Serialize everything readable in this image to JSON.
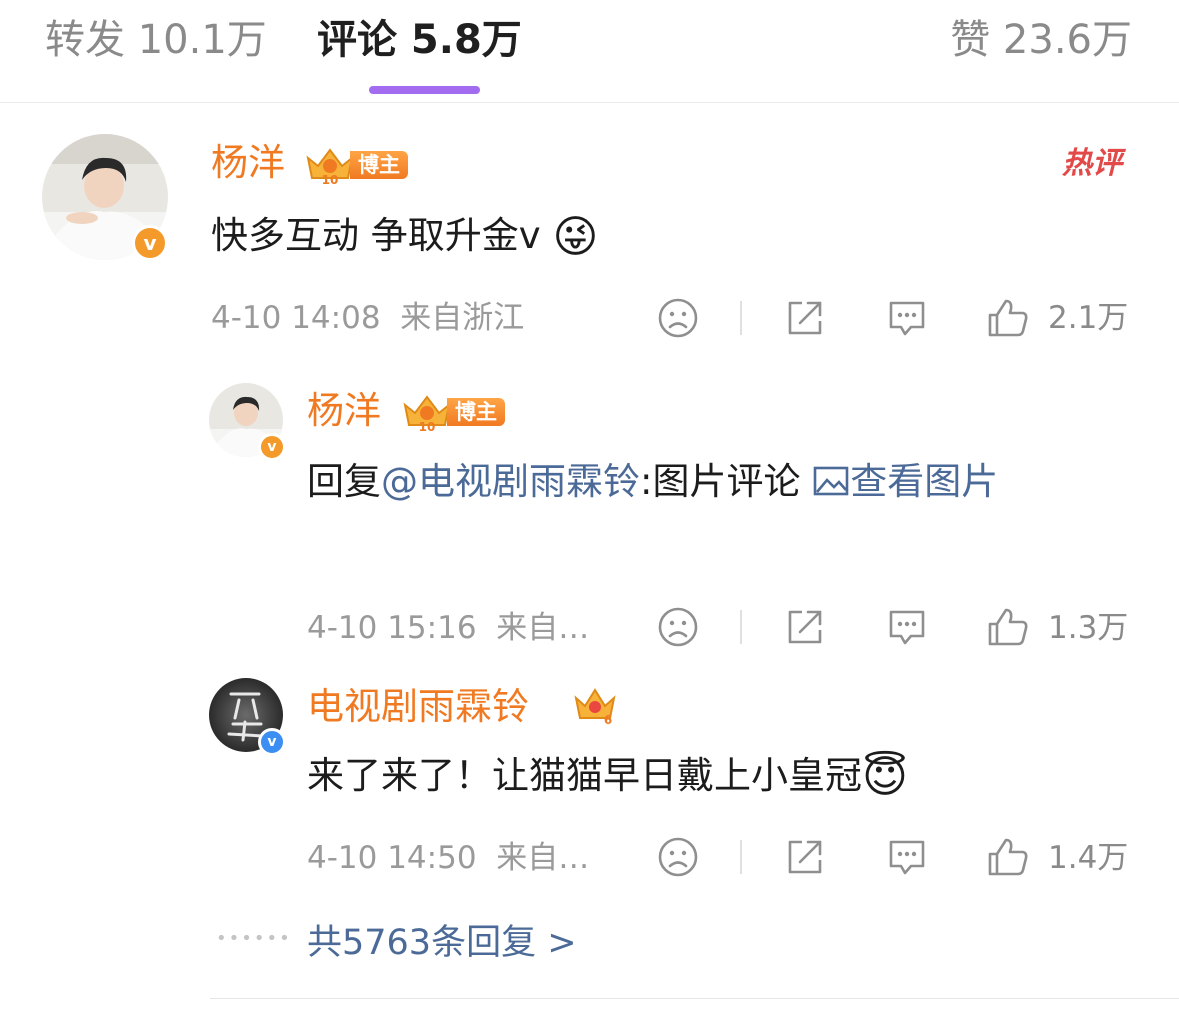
{
  "tabs": [
    {
      "label": "转发 10.1万"
    },
    {
      "label": "评论 5.8万"
    },
    {
      "label": "赞 23.6万"
    }
  ],
  "hot_label": "热评",
  "comments": [
    {
      "author": "杨洋",
      "badge_label": "博主",
      "badge_level": "10",
      "text": "快多互动 争取升金v",
      "emoji": "😜",
      "time": "4-10 14:08",
      "location": "来自浙江",
      "likes": "2.1万"
    }
  ],
  "replies": [
    {
      "author": "杨洋",
      "badge_label": "博主",
      "badge_level": "10",
      "prefix": "回复",
      "mention": "@电视剧雨霖铃",
      "mid": ":图片评论",
      "image_link": "查看图片",
      "time": "4-10 15:16",
      "location": "来自…",
      "likes": "1.3万"
    },
    {
      "author": "电视剧雨霖铃",
      "badge_level": "6",
      "text": "来了来了！让猫猫早日戴上小皇冠",
      "emoji": "😇",
      "time": "4-10 14:50",
      "location": "来自…",
      "likes": "1.4万"
    }
  ],
  "more_link": "共5763条回复 >",
  "colors": {
    "name": "#f07a22",
    "link": "#4c6a97",
    "tab_underline": "#a36bf0",
    "hot": "#e24a4a"
  }
}
